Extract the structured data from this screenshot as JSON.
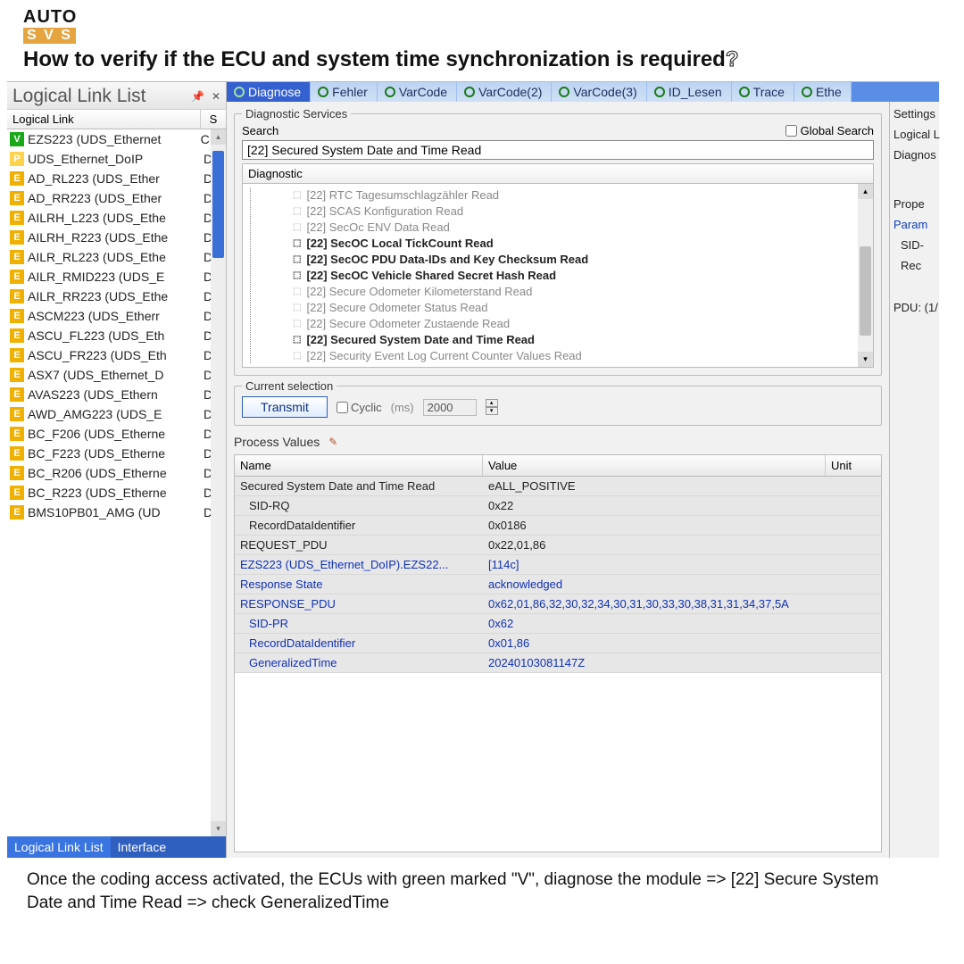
{
  "logo": {
    "top": "AUTO",
    "bottom": "S V S"
  },
  "title_main": "How to verify if the ECU and system time synchronization is required",
  "title_q": "?",
  "left_title": "Logical Link List",
  "pin_glyph": "📌",
  "close_glyph": "✕",
  "header": {
    "c1": "Logical Link",
    "c2": "S"
  },
  "links": [
    {
      "ic": "V",
      "cls": "ic-v",
      "txt": "EZS223 (UDS_Ethernet",
      "s": "C"
    },
    {
      "ic": "P",
      "cls": "ic-p",
      "txt": "UDS_Ethernet_DoIP",
      "s": "D"
    },
    {
      "ic": "E",
      "cls": "ic-e",
      "txt": "AD_RL223 (UDS_Ether",
      "s": "D"
    },
    {
      "ic": "E",
      "cls": "ic-e",
      "txt": "AD_RR223 (UDS_Ether",
      "s": "D"
    },
    {
      "ic": "E",
      "cls": "ic-e",
      "txt": "AILRH_L223 (UDS_Ethe",
      "s": "D"
    },
    {
      "ic": "E",
      "cls": "ic-e",
      "txt": "AILRH_R223 (UDS_Ethe",
      "s": "D"
    },
    {
      "ic": "E",
      "cls": "ic-e",
      "txt": "AILR_RL223 (UDS_Ethe",
      "s": "D"
    },
    {
      "ic": "E",
      "cls": "ic-e",
      "txt": "AILR_RMID223 (UDS_E",
      "s": "D"
    },
    {
      "ic": "E",
      "cls": "ic-e",
      "txt": "AILR_RR223 (UDS_Ethe",
      "s": "D"
    },
    {
      "ic": "E",
      "cls": "ic-e",
      "txt": "ASCM223 (UDS_Etherr",
      "s": "D"
    },
    {
      "ic": "E",
      "cls": "ic-e",
      "txt": "ASCU_FL223 (UDS_Eth",
      "s": "D"
    },
    {
      "ic": "E",
      "cls": "ic-e",
      "txt": "ASCU_FR223 (UDS_Eth",
      "s": "D"
    },
    {
      "ic": "E",
      "cls": "ic-e",
      "txt": "ASX7 (UDS_Ethernet_D",
      "s": "D"
    },
    {
      "ic": "E",
      "cls": "ic-e",
      "txt": "AVAS223 (UDS_Ethern",
      "s": "D"
    },
    {
      "ic": "E",
      "cls": "ic-e",
      "txt": "AWD_AMG223 (UDS_E",
      "s": "D"
    },
    {
      "ic": "E",
      "cls": "ic-e",
      "txt": "BC_F206 (UDS_Etherne",
      "s": "D"
    },
    {
      "ic": "E",
      "cls": "ic-e",
      "txt": "BC_F223 (UDS_Etherne",
      "s": "D"
    },
    {
      "ic": "E",
      "cls": "ic-e",
      "txt": "BC_R206 (UDS_Etherne",
      "s": "D"
    },
    {
      "ic": "E",
      "cls": "ic-e",
      "txt": "BC_R223 (UDS_Etherne",
      "s": "D"
    },
    {
      "ic": "E",
      "cls": "ic-e",
      "txt": "BMS10PB01_AMG (UD",
      "s": "D"
    }
  ],
  "bottom_tabs": {
    "t1": "Logical Link List",
    "t2": "Interface"
  },
  "main_tabs": [
    "Diagnose",
    "Fehler",
    "VarCode",
    "VarCode(2)",
    "VarCode(3)",
    "ID_Lesen",
    "Trace",
    "Ethe"
  ],
  "ds_legend": "Diagnostic Services",
  "search_label": "Search",
  "global_search": "Global Search",
  "search_value": "[22] Secured System Date and Time Read",
  "diag_header": "Diagnostic",
  "diag_items": [
    {
      "txt": "[22] RTC Tagesumschlagzähler Read",
      "bold": false
    },
    {
      "txt": "[22] SCAS Konfiguration Read",
      "bold": false
    },
    {
      "txt": "[22] SecOc ENV Data Read",
      "bold": false
    },
    {
      "txt": "[22] SecOC Local TickCount Read",
      "bold": true
    },
    {
      "txt": "[22] SecOC PDU Data-IDs and Key Checksum Read",
      "bold": true
    },
    {
      "txt": "[22] SecOC Vehicle Shared Secret Hash Read",
      "bold": true
    },
    {
      "txt": "[22] Secure Odometer Kilometerstand Read",
      "bold": false
    },
    {
      "txt": "[22] Secure Odometer Status Read",
      "bold": false
    },
    {
      "txt": "[22] Secure Odometer Zustaende Read",
      "bold": false
    },
    {
      "txt": "[22] Secured System Date and Time Read",
      "bold": true
    },
    {
      "txt": "[22] Security Event Log Current Counter Values Read",
      "bold": false
    }
  ],
  "cs_legend": "Current selection",
  "transmit": "Transmit",
  "cyclic": "Cyclic",
  "ms": "(ms)",
  "ms_val": "2000",
  "pv_title": "Process Values",
  "pv_headers": {
    "name": "Name",
    "value": "Value",
    "unit": "Unit"
  },
  "pv_rows": [
    {
      "n": "Secured System Date and Time Read",
      "v": "eALL_POSITIVE",
      "blue": false,
      "ind": false
    },
    {
      "n": "SID-RQ",
      "v": "0x22",
      "blue": false,
      "ind": true
    },
    {
      "n": "RecordDataIdentifier",
      "v": "0x0186",
      "blue": false,
      "ind": true
    },
    {
      "n": "REQUEST_PDU",
      "v": "0x22,01,86",
      "blue": false,
      "ind": false
    },
    {
      "n": "EZS223 (UDS_Ethernet_DoIP).EZS22...",
      "v": "[114c]",
      "blue": true,
      "ind": false
    },
    {
      "n": "Response State",
      "v": "acknowledged",
      "blue": true,
      "ind": false
    },
    {
      "n": "RESPONSE_PDU",
      "v": "0x62,01,86,32,30,32,34,30,31,30,33,30,38,31,31,34,37,5A",
      "blue": true,
      "ind": false
    },
    {
      "n": "SID-PR",
      "v": "0x62",
      "blue": true,
      "ind": true
    },
    {
      "n": "RecordDataIdentifier",
      "v": "0x01,86",
      "blue": true,
      "ind": true
    },
    {
      "n": "GeneralizedTime",
      "v": "20240103081147Z",
      "blue": true,
      "ind": true
    }
  ],
  "east": {
    "settings": "Settings",
    "logical": "Logical L",
    "diagnos": "Diagnos",
    "prope": "Prope",
    "param": "Param",
    "sid": "SID-",
    "rec": "Rec",
    "pdu": "PDU: (1/"
  },
  "footnote": "Once the coding access activated, the ECUs with green marked \"V\", diagnose the module => [22] Secure System Date and Time Read => check GeneralizedTime"
}
